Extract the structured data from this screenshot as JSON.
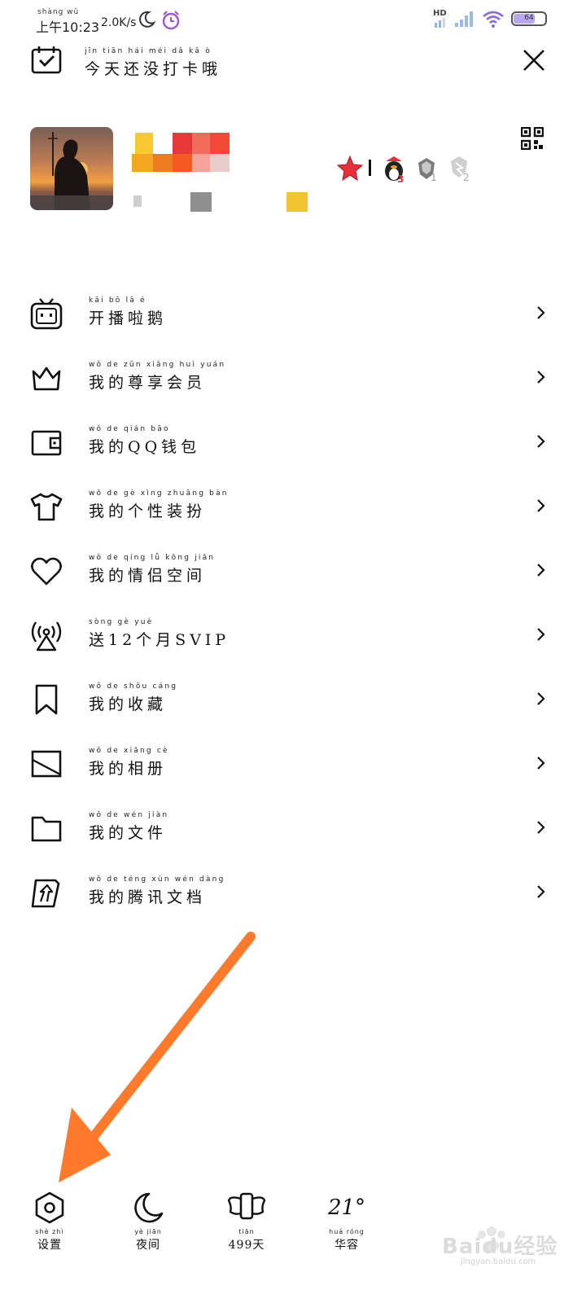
{
  "status_bar": {
    "time_pinyin": "shàng wǔ",
    "time": "上午10:23",
    "net_speed": "2.0K/s",
    "hd": "HD",
    "battery": "64"
  },
  "header": {
    "checkin_pinyin": "jīn tiān hái méi dǎ kǎ ò",
    "checkin_text": "今天还没打卡哦"
  },
  "menu": {
    "items": [
      {
        "pinyin": "kāi bō lā é",
        "label": "开播啦鹅",
        "icon": "tv-icon"
      },
      {
        "pinyin": "wǒ de zūn xiǎng huì yuán",
        "label": "我的尊享会员",
        "icon": "crown-icon"
      },
      {
        "pinyin": "wǒ de qián bāo",
        "label": "我的QQ钱包",
        "icon": "wallet-icon"
      },
      {
        "pinyin": "wǒ de gè xìng zhuāng bàn",
        "label": "我的个性装扮",
        "icon": "tshirt-icon"
      },
      {
        "pinyin": "wǒ de qíng lǚ kōng jiān",
        "label": "我的情侣空间",
        "icon": "heart-icon"
      },
      {
        "pinyin": "sòng gè yuè",
        "label": "送12个月SVIP",
        "icon": "antenna-icon"
      },
      {
        "pinyin": "wǒ de shōu cáng",
        "label": "我的收藏",
        "icon": "bookmark-icon"
      },
      {
        "pinyin": "wǒ de xiāng cè",
        "label": "我的相册",
        "icon": "image-icon"
      },
      {
        "pinyin": "wǒ de wén jiàn",
        "label": "我的文件",
        "icon": "folder-icon"
      },
      {
        "pinyin": "wǒ de téng xùn wén dàng",
        "label": "我的腾讯文档",
        "icon": "docs-icon"
      }
    ]
  },
  "bottom_bar": {
    "settings_pinyin": "shè zhì",
    "settings": "设置",
    "night_pinyin": "yè jiān",
    "night": "夜间",
    "days_pinyin": "tiān",
    "days": "499天",
    "temperature": "21°",
    "city_pinyin": "huá róng",
    "city": "华容"
  },
  "watermark": {
    "text": "Baidu经验",
    "sub": "jingyan.baidu.com"
  },
  "colors": {
    "arrow": "#ff7a2a",
    "text": "#111111",
    "battery_fill": "#b9a6f0"
  }
}
